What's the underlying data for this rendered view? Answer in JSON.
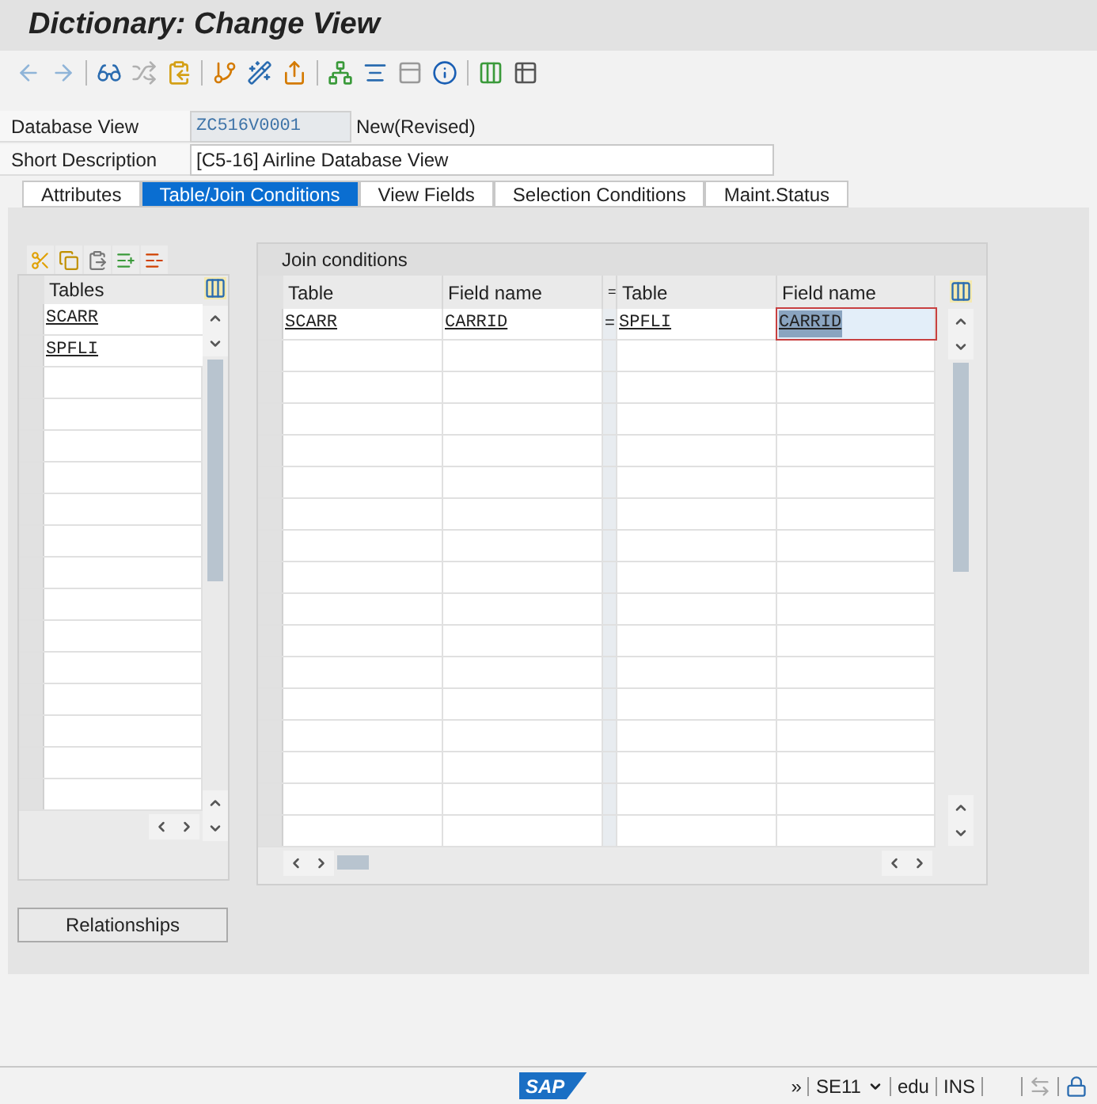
{
  "window": {
    "title": "Dictionary: Change View"
  },
  "fields": [
    {
      "label": "Database View",
      "value": "ZC516V0001",
      "note": "New(Revised)",
      "kind": "readonly"
    },
    {
      "label": "Short Description",
      "value": "[C5-16] Airline Database View",
      "kind": "input"
    }
  ],
  "tabs": [
    {
      "label": "Attributes",
      "selected": false
    },
    {
      "label": "Table/Join Conditions",
      "selected": true
    },
    {
      "label": "View Fields",
      "selected": false
    },
    {
      "label": "Selection Conditions",
      "selected": false
    },
    {
      "label": "Maint.Status",
      "selected": false
    }
  ],
  "tables": {
    "column": "Tables",
    "rows": [
      "SCARR",
      "SPFLI"
    ]
  },
  "join": {
    "title": "Join conditions",
    "columns": [
      "Table",
      "Field name",
      "=",
      "Table",
      "Field name"
    ],
    "rows": [
      {
        "cells": [
          {
            "text": "SCARR",
            "selected": false
          },
          {
            "text": "CARRID",
            "selected": false
          },
          {
            "text": "=",
            "selected": false
          },
          {
            "text": "SPFLI",
            "selected": false
          },
          {
            "text": "CARRID",
            "selected": true
          }
        ]
      }
    ]
  },
  "relationships_button": "Relationships",
  "status_bar": {
    "logo": "SAP",
    "items": [
      "»",
      "SE11",
      "edu",
      "INS"
    ]
  }
}
